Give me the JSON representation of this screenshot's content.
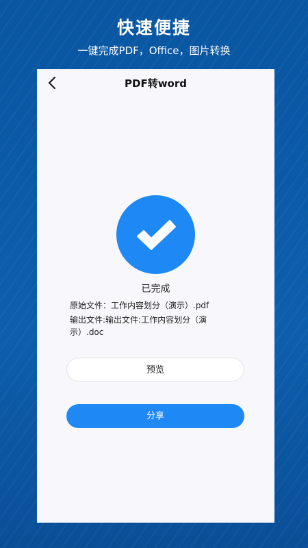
{
  "promo": {
    "title": "快速便捷",
    "subtitle": "一键完成PDF，Office，图片转换"
  },
  "nav": {
    "back_icon": "chevron-left-icon",
    "title": "PDF转word"
  },
  "result": {
    "icon": "checkmark-icon",
    "status": "已完成",
    "source_file": "原始文件：工作内容划分（演示）.pdf",
    "output_file": "输出文件:输出文件:工作内容划分（演示）.doc"
  },
  "actions": {
    "preview_label": "预览",
    "share_label": "分享"
  },
  "colors": {
    "accent": "#1e88f5",
    "background": "#0b5aa8",
    "card": "#f8f8fc"
  }
}
